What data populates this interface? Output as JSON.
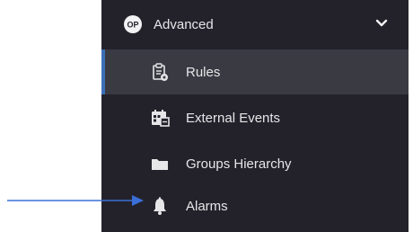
{
  "sidebar": {
    "section": {
      "label": "Advanced",
      "badge_text": "OP",
      "icon": "advanced-badge-icon",
      "expand_icon": "chevron-down-icon"
    },
    "items": [
      {
        "label": "Rules",
        "icon": "clipboard-gear-icon",
        "active": true
      },
      {
        "label": "External Events",
        "icon": "calendar-events-icon",
        "active": false
      },
      {
        "label": "Groups Hierarchy",
        "icon": "folder-icon",
        "active": false
      },
      {
        "label": "Alarms",
        "icon": "bell-icon",
        "active": false
      }
    ]
  },
  "annotation": {
    "type": "arrow",
    "points_to": "Alarms",
    "color": "#3a6fd8"
  },
  "colors": {
    "sidebar_bg": "#23222b",
    "active_bg": "#3a3a42",
    "active_border": "#3b6fb6",
    "text": "#e6e6e9"
  }
}
